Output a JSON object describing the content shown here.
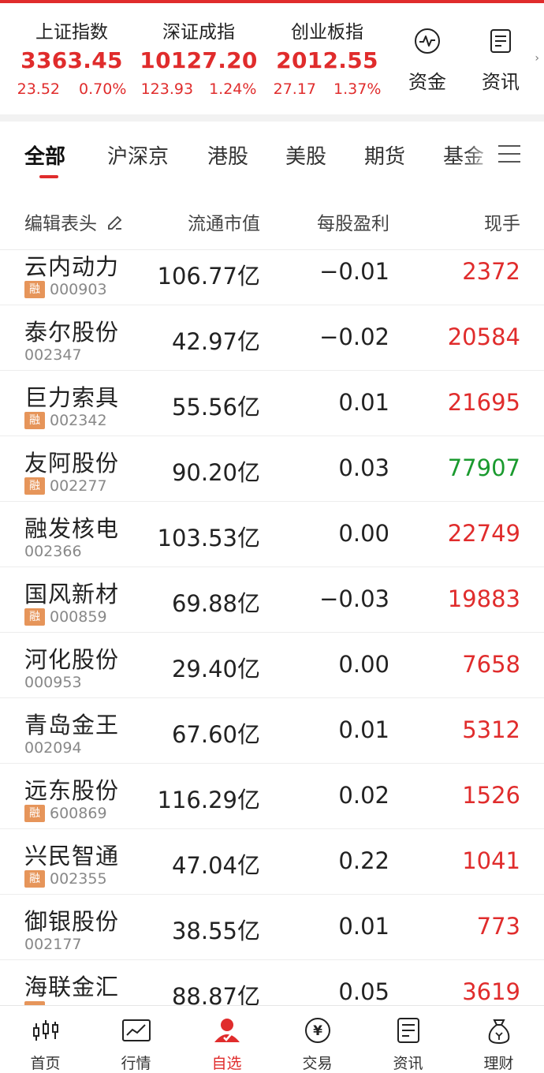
{
  "indices": [
    {
      "name": "上证指数",
      "value": "3363.45",
      "change": "23.52",
      "pct": "0.70%"
    },
    {
      "name": "深证成指",
      "value": "10127.20",
      "change": "123.93",
      "pct": "1.24%"
    },
    {
      "name": "创业板指",
      "value": "2012.55",
      "change": "27.17",
      "pct": "1.37%"
    }
  ],
  "quick_links": [
    {
      "label": "资金",
      "icon": "capital-flow-icon"
    },
    {
      "label": "资讯",
      "icon": "news-icon"
    }
  ],
  "tabs": [
    "全部",
    "沪深京",
    "港股",
    "美股",
    "期货",
    "基金"
  ],
  "active_tab": "全部",
  "columns": {
    "edit": "编辑表头",
    "market_cap": "流通市值",
    "eps": "每股盈利",
    "volume": "现手"
  },
  "stocks": [
    {
      "name": "云内动力",
      "code": "000903",
      "margin": "融",
      "market_cap": "106.77亿",
      "eps": "−0.01",
      "volume": "2372",
      "volume_color": "red"
    },
    {
      "name": "泰尔股份",
      "code": "002347",
      "margin": "",
      "market_cap": "42.97亿",
      "eps": "−0.02",
      "volume": "20584",
      "volume_color": "red"
    },
    {
      "name": "巨力索具",
      "code": "002342",
      "margin": "融",
      "market_cap": "55.56亿",
      "eps": "0.01",
      "volume": "21695",
      "volume_color": "red"
    },
    {
      "name": "友阿股份",
      "code": "002277",
      "margin": "融",
      "market_cap": "90.20亿",
      "eps": "0.03",
      "volume": "77907",
      "volume_color": "green"
    },
    {
      "name": "融发核电",
      "code": "002366",
      "margin": "",
      "market_cap": "103.53亿",
      "eps": "0.00",
      "volume": "22749",
      "volume_color": "red"
    },
    {
      "name": "国风新材",
      "code": "000859",
      "margin": "融",
      "market_cap": "69.88亿",
      "eps": "−0.03",
      "volume": "19883",
      "volume_color": "red"
    },
    {
      "name": "河化股份",
      "code": "000953",
      "margin": "",
      "market_cap": "29.40亿",
      "eps": "0.00",
      "volume": "7658",
      "volume_color": "red"
    },
    {
      "name": "青岛金王",
      "code": "002094",
      "margin": "",
      "market_cap": "67.60亿",
      "eps": "0.01",
      "volume": "5312",
      "volume_color": "red"
    },
    {
      "name": "远东股份",
      "code": "600869",
      "margin": "融",
      "market_cap": "116.29亿",
      "eps": "0.02",
      "volume": "1526",
      "volume_color": "red"
    },
    {
      "name": "兴民智通",
      "code": "002355",
      "margin": "融",
      "market_cap": "47.04亿",
      "eps": "0.22",
      "volume": "1041",
      "volume_color": "red"
    },
    {
      "name": "御银股份",
      "code": "002177",
      "margin": "",
      "market_cap": "38.55亿",
      "eps": "0.01",
      "volume": "773",
      "volume_color": "red"
    },
    {
      "name": "海联金汇",
      "code": "",
      "margin": "",
      "market_cap": "88.87亿",
      "eps": "0.05",
      "volume": "3619",
      "volume_color": "red"
    }
  ],
  "nav": [
    {
      "label": "首页",
      "icon": "home-candlestick-icon"
    },
    {
      "label": "行情",
      "icon": "market-chart-icon"
    },
    {
      "label": "自选",
      "icon": "watchlist-person-icon"
    },
    {
      "label": "交易",
      "icon": "trade-yuan-icon"
    },
    {
      "label": "资讯",
      "icon": "news-doc-icon"
    },
    {
      "label": "理财",
      "icon": "wealth-bag-icon"
    }
  ],
  "active_nav": "自选",
  "colors": {
    "red": "#e02c2c",
    "green": "#1a9a2e",
    "badge": "#e6955a"
  }
}
